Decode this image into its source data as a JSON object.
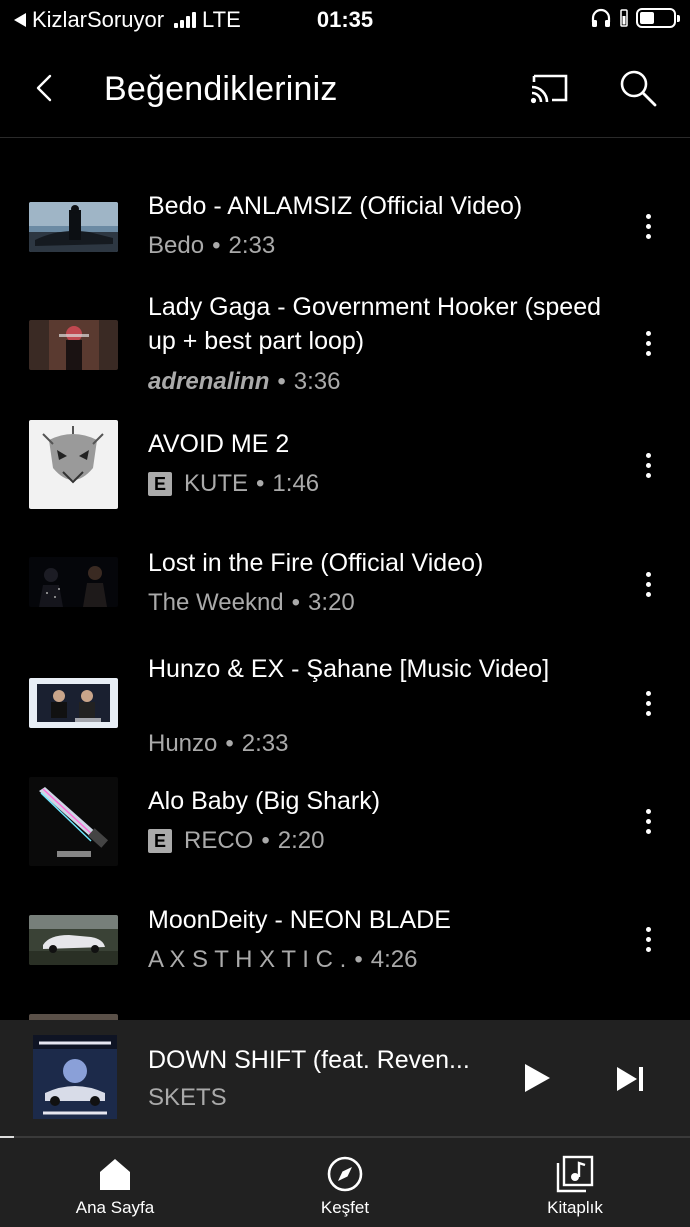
{
  "status_bar": {
    "carrier": "KizlarSoruyor",
    "network": "LTE",
    "time": "01:35"
  },
  "header": {
    "title": "Beğendikleriniz",
    "back_icon": "chevron-left-icon",
    "cast_icon": "cast-icon",
    "search_icon": "search-icon"
  },
  "songs": [
    {
      "title": "Bedo - ANLAMSIZ (Official Video)",
      "artist": "Bedo",
      "duration": "2:33",
      "explicit": false
    },
    {
      "title": "Lady Gaga - Government Hooker (speed up + best part loop)",
      "artist": "adrenalinn",
      "duration": "3:36",
      "explicit": false
    },
    {
      "title": "AVOID ME 2",
      "artist": "KUTE",
      "duration": "1:46",
      "explicit": true
    },
    {
      "title": "Lost in the Fire (Official Video)",
      "artist": "The Weeknd",
      "duration": "3:20",
      "explicit": false
    },
    {
      "title": "Hunzo & EX - Şahane [Music Video]",
      "artist": "Hunzo",
      "duration": "2:33",
      "explicit": false
    },
    {
      "title": "Alo Baby (Big Shark)",
      "artist": "RECO",
      "duration": "2:20",
      "explicit": true
    },
    {
      "title": "MoonDeity - NEON BLADE",
      "artist": "A X S T H X T I C .",
      "duration": "4:26",
      "explicit": false
    }
  ],
  "separator": "•",
  "explicit_badge": "E",
  "mini_player": {
    "title": "DOWN SHIFT (feat. Reven...",
    "artist": "SKETS",
    "progress": 0.02
  },
  "bottom_nav": [
    {
      "label": "Ana Sayfa",
      "icon": "home-icon"
    },
    {
      "label": "Keşfet",
      "icon": "compass-icon"
    },
    {
      "label": "Kitaplık",
      "icon": "library-icon"
    }
  ]
}
